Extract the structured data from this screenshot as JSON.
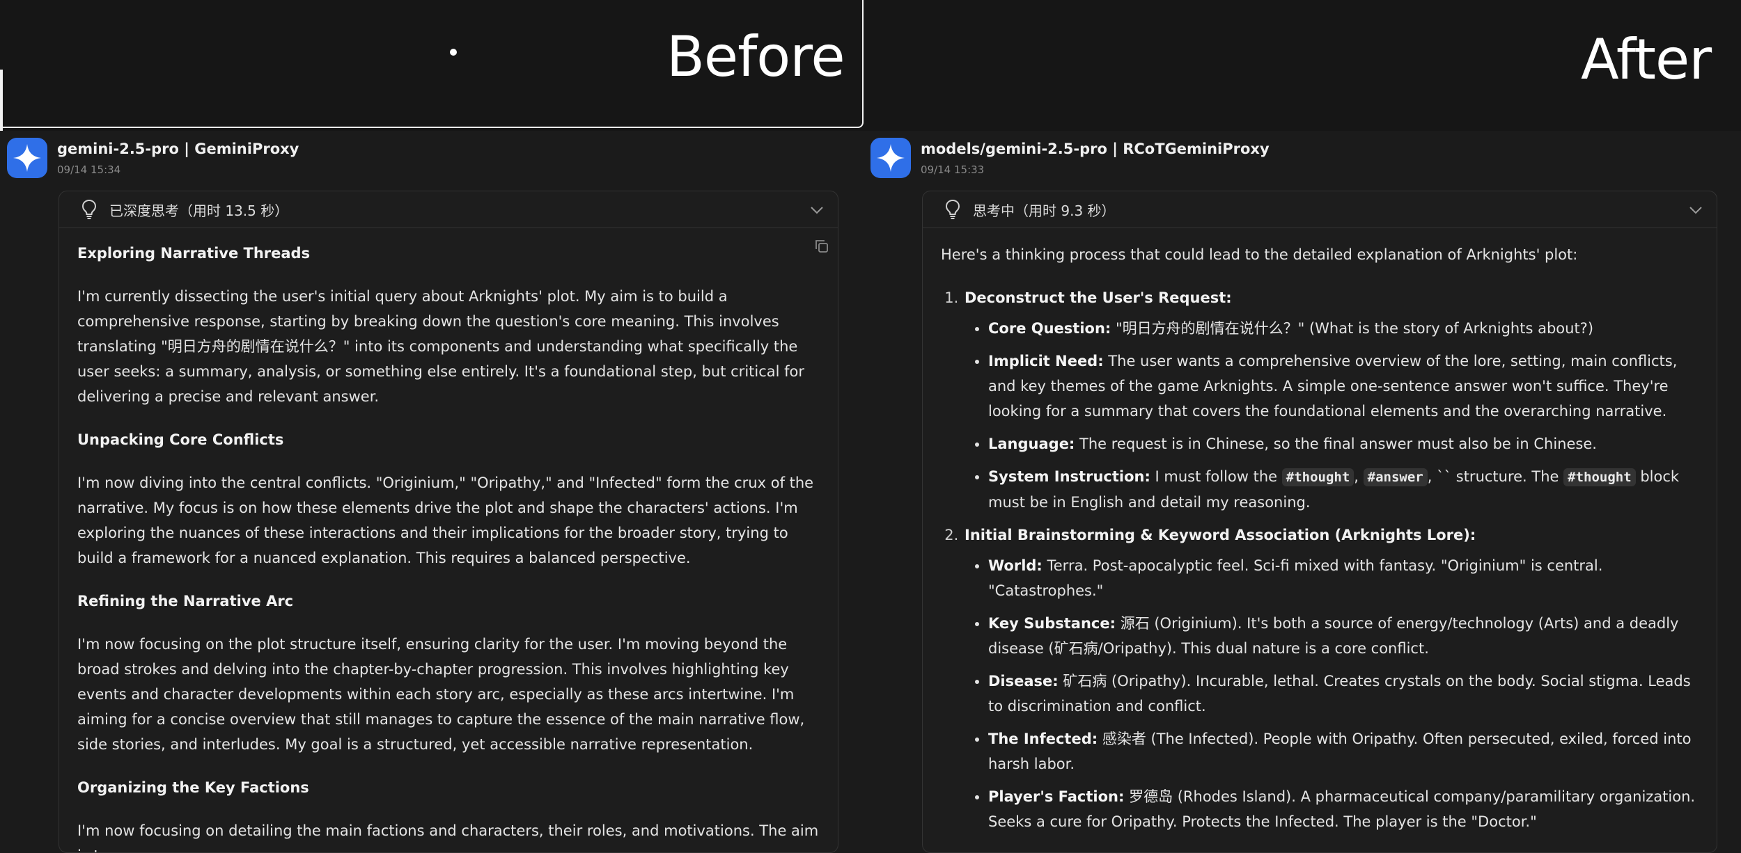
{
  "header": {
    "before_label": "Before",
    "after_label": "After"
  },
  "left": {
    "model": "gemini-2.5-pro | GeminiProxy",
    "timestamp": "09/14 15:34",
    "thinking_label": "已深度思考（用时 13.5 秒）",
    "sections": [
      {
        "title": "Exploring Narrative Threads",
        "text": "I'm currently dissecting the user's initial query about Arknights' plot. My aim is to build a comprehensive response, starting by breaking down the question's core meaning. This involves translating \"明日方舟的剧情在说什么？\" into its components and understanding what specifically the user seeks: a summary, analysis, or something else entirely. It's a foundational step, but critical for delivering a precise and relevant answer."
      },
      {
        "title": "Unpacking Core Conflicts",
        "text": "I'm now diving into the central conflicts. \"Originium,\" \"Oripathy,\" and \"Infected\" form the crux of the narrative. My focus is on how these elements drive the plot and shape the characters' actions. I'm exploring the nuances of these interactions and their implications for the broader story, trying to build a framework for a nuanced explanation. This requires a balanced perspective."
      },
      {
        "title": "Refining the Narrative Arc",
        "text": "I'm now focusing on the plot structure itself, ensuring clarity for the user. I'm moving beyond the broad strokes and delving into the chapter-by-chapter progression. This involves highlighting key events and character developments within each story arc, especially as these arcs intertwine. I'm aiming for a concise overview that still manages to capture the essence of the main narrative flow, side stories, and interludes. My goal is a structured, yet accessible narrative representation."
      },
      {
        "title": "Organizing the Key Factions",
        "text": "I'm now focusing on detailing the main factions and characters, their roles, and motivations. The aim is to"
      }
    ]
  },
  "right": {
    "model": "models/gemini-2.5-pro | RCoTGeminiProxy",
    "timestamp": "09/14 15:33",
    "thinking_label": "思考中（用时 9.3 秒）",
    "intro": "Here's a thinking process that could lead to the detailed explanation of Arknights' plot:",
    "step1": {
      "title": "Deconstruct the User's Request:",
      "core_label": "Core Question:",
      "core_text": " \"明日方舟的剧情在说什么？\" (What is the story of Arknights about?)",
      "need_label": "Implicit Need:",
      "need_text": " The user wants a comprehensive overview of the lore, setting, main conflicts, and key themes of the game Arknights. A simple one-sentence answer won't suffice. They're looking for a summary that covers the foundational elements and the overarching narrative.",
      "lang_label": "Language:",
      "lang_text": " The request is in Chinese, so the final answer must also be in Chinese.",
      "sys_label": "System Instruction:",
      "sys_text1": " I must follow the ",
      "code_thought": "#thought",
      "sys_sep1": ", ",
      "code_answer": "#answer",
      "sys_text2": ", `` structure. The ",
      "code_thought2": "#thought",
      "sys_text3": " block must be in English and detail my reasoning."
    },
    "step2": {
      "title": "Initial Brainstorming & Keyword Association (Arknights Lore):",
      "items": [
        {
          "label": "World:",
          "text": " Terra. Post-apocalyptic feel. Sci-fi mixed with fantasy. \"Originium\" is central. \"Catastrophes.\""
        },
        {
          "label": "Key Substance:",
          "text": " 源石 (Originium). It's both a source of energy/technology (Arts) and a deadly disease (矿石病/Oripathy). This dual nature is a core conflict."
        },
        {
          "label": "Disease:",
          "text": " 矿石病 (Oripathy). Incurable, lethal. Creates crystals on the body. Social stigma. Leads to discrimination and conflict."
        },
        {
          "label": "The Infected:",
          "text": " 感染者 (The Infected). People with Oripathy. Often persecuted, exiled, forced into harsh labor."
        },
        {
          "label": "Player's Faction:",
          "text": " 罗德岛 (Rhodes Island). A pharmaceutical company/paramilitary organization. Seeks a cure for Oripathy. Protects the Infected. The player is the \"Doctor.\""
        }
      ]
    }
  }
}
